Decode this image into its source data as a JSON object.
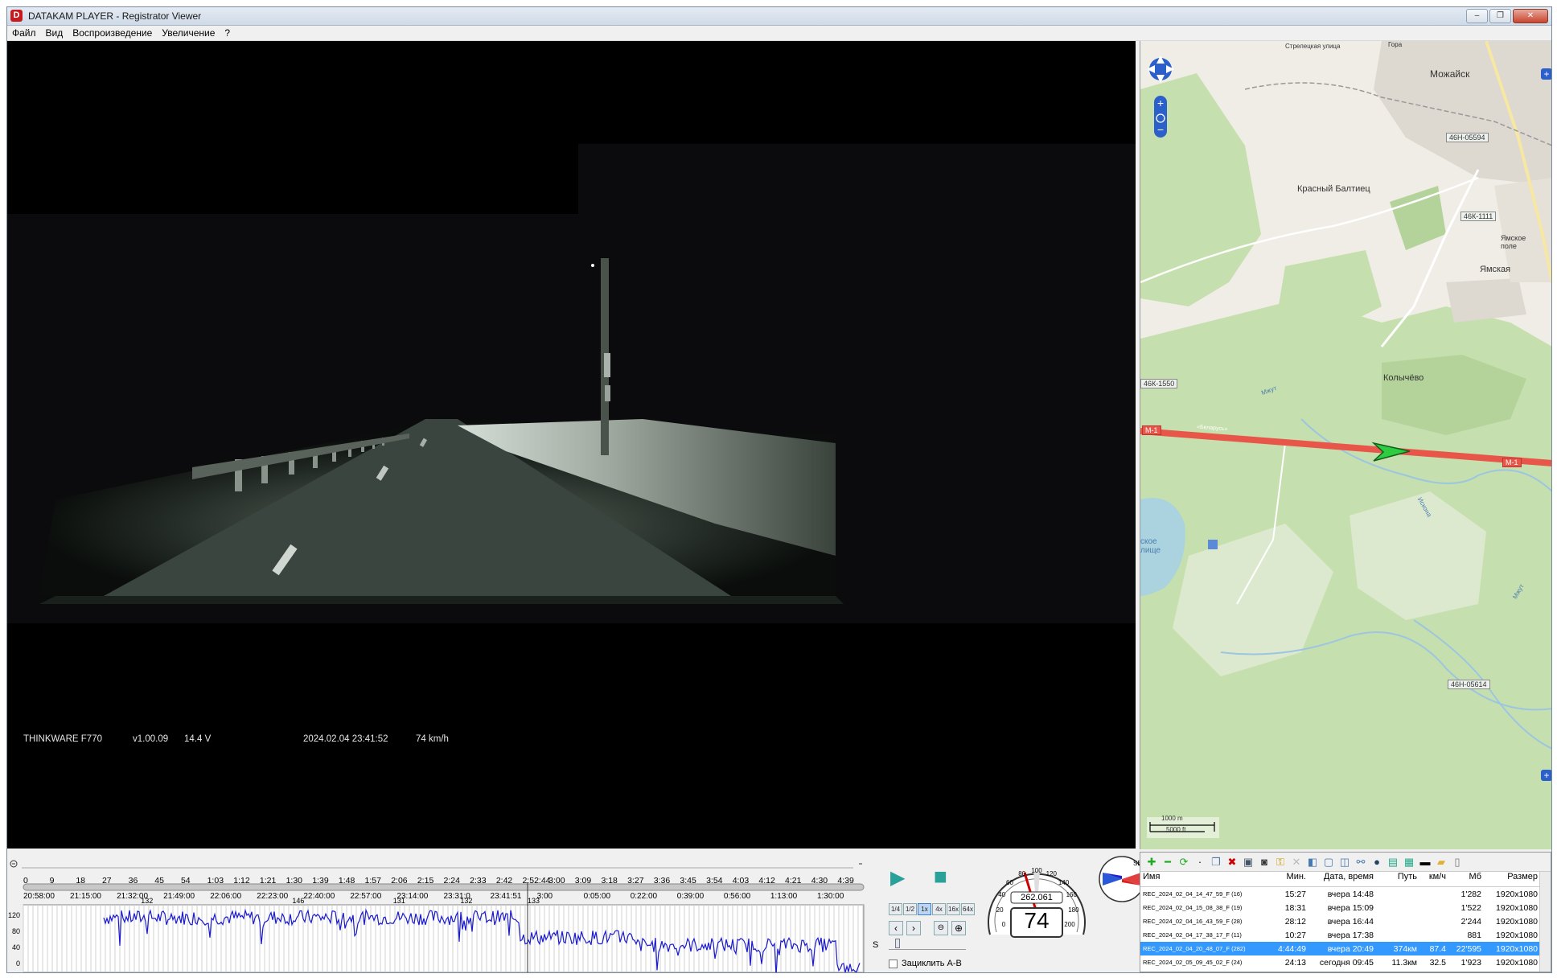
{
  "window": {
    "title": "DATAKAM PLAYER - Registrator Viewer",
    "app_icon": "D",
    "controls": {
      "minimize": "–",
      "maximize": "❐",
      "close": "✕"
    }
  },
  "menu": [
    "Файл",
    "Вид",
    "Воспроизведение",
    "Увеличение",
    "?"
  ],
  "video": {
    "osd": {
      "model": "THINKWARE F770",
      "firmware": "v1.00.09",
      "voltage": "14.4 V",
      "datetime": "2024.02.04 23:41:52",
      "speed": "74 km/h"
    }
  },
  "map": {
    "labels": {
      "city": "Можайск",
      "village1": "Красный Балтиец",
      "village2": "Ямская",
      "village3": "Ямское поле",
      "village4": "Колычёво",
      "lake": "ское лище",
      "street": "Стрелецкая улица",
      "hill": "Гора",
      "river1": "Мжут",
      "river2": "Искона",
      "river3": "Мжут",
      "highway_name": "«Беларусь»"
    },
    "road_tags": [
      "46Н-05594",
      "46К-1111",
      "46К-1550",
      "М-1",
      "М-1",
      "46Н-05614"
    ],
    "scale": {
      "top": "1000 m",
      "bottom": "5000 ft"
    },
    "colors": {
      "highway": "#e8564a",
      "forest": "#b8d6a0",
      "water": "#aad3df",
      "arrow": "#2ecc40"
    }
  },
  "timeline": {
    "top_ticks": [
      "0",
      "9",
      "18",
      "27",
      "36",
      "45",
      "54",
      "1:03",
      "1:12",
      "1:21",
      "1:30",
      "1:39",
      "1:48",
      "1:57",
      "2:06",
      "2:15",
      "2:24",
      "2:33",
      "2:42",
      "2:52:44",
      "3:00",
      "3:09",
      "3:18",
      "3:27",
      "3:36",
      "3:45",
      "3:54",
      "4:03",
      "4:12",
      "4:21",
      "4:30",
      "4:39"
    ],
    "clock_ticks": [
      "20:58:00",
      "21:15:00",
      "21:32:00",
      "21:49:00",
      "22:06:00",
      "22:23:00",
      "22:40:00",
      "22:57:00",
      "23:14:00",
      "23:31:0",
      "23:41:51",
      "3:00",
      "0:05:00",
      "0:22:00",
      "0:39:00",
      "0:56:00",
      "1:13:00",
      "1:30:00"
    ],
    "position_fraction": 0.6
  },
  "graph": {
    "y_ticks": [
      "120",
      "80",
      "40",
      "0"
    ],
    "peak_labels": [
      "132",
      "146",
      "131",
      "132",
      "133"
    ],
    "line_color": "#1a1acc"
  },
  "controls": {
    "play_icon": "▶",
    "stop_icon": "■",
    "speed_buttons": [
      "1/4",
      "1/2",
      "1x",
      "4x",
      "16x",
      "64x"
    ],
    "active_speed": "1x",
    "loop_label": "Зациклить А-В",
    "s_label": "S"
  },
  "speedometer": {
    "speed": "74",
    "odometer": "262.061",
    "ticks": [
      "0",
      "20",
      "40",
      "60",
      "80",
      "100",
      "120",
      "140",
      "160",
      "180",
      "200"
    ]
  },
  "compass": {
    "label": "SE"
  },
  "filelist": {
    "columns": [
      "Имя",
      "Мин.",
      "Дата, время",
      "Путь",
      "км/ч",
      "Мб",
      "Размер"
    ],
    "rows": [
      {
        "name": "REC_2024_02_04_14_47_59_F (16)",
        "min": "15:27",
        "dt": "вчера 14:48",
        "path": "",
        "kmh": "",
        "mb": "1'282",
        "size": "1920x1080",
        "selected": false
      },
      {
        "name": "REC_2024_02_04_15_08_38_F (19)",
        "min": "18:31",
        "dt": "вчера 15:09",
        "path": "",
        "kmh": "",
        "mb": "1'522",
        "size": "1920x1080",
        "selected": false
      },
      {
        "name": "REC_2024_02_04_16_43_59_F (28)",
        "min": "28:12",
        "dt": "вчера 16:44",
        "path": "",
        "kmh": "",
        "mb": "2'244",
        "size": "1920x1080",
        "selected": false
      },
      {
        "name": "REC_2024_02_04_17_38_17_F (11)",
        "min": "10:27",
        "dt": "вчера 17:38",
        "path": "",
        "kmh": "",
        "mb": "881",
        "size": "1920x1080",
        "selected": false
      },
      {
        "name": "REC_2024_02_04_20_48_07_F (282)",
        "min": "4:44:49",
        "dt": "вчера 20:49",
        "path": "374км",
        "kmh": "87.4",
        "mb": "22'595",
        "size": "1920x1080",
        "selected": true
      },
      {
        "name": "REC_2024_02_05_09_45_02_F (24)",
        "min": "24:13",
        "dt": "сегодня 09:45",
        "path": "11.3км",
        "kmh": "32.5",
        "mb": "1'923",
        "size": "1920x1080",
        "selected": false
      }
    ]
  }
}
